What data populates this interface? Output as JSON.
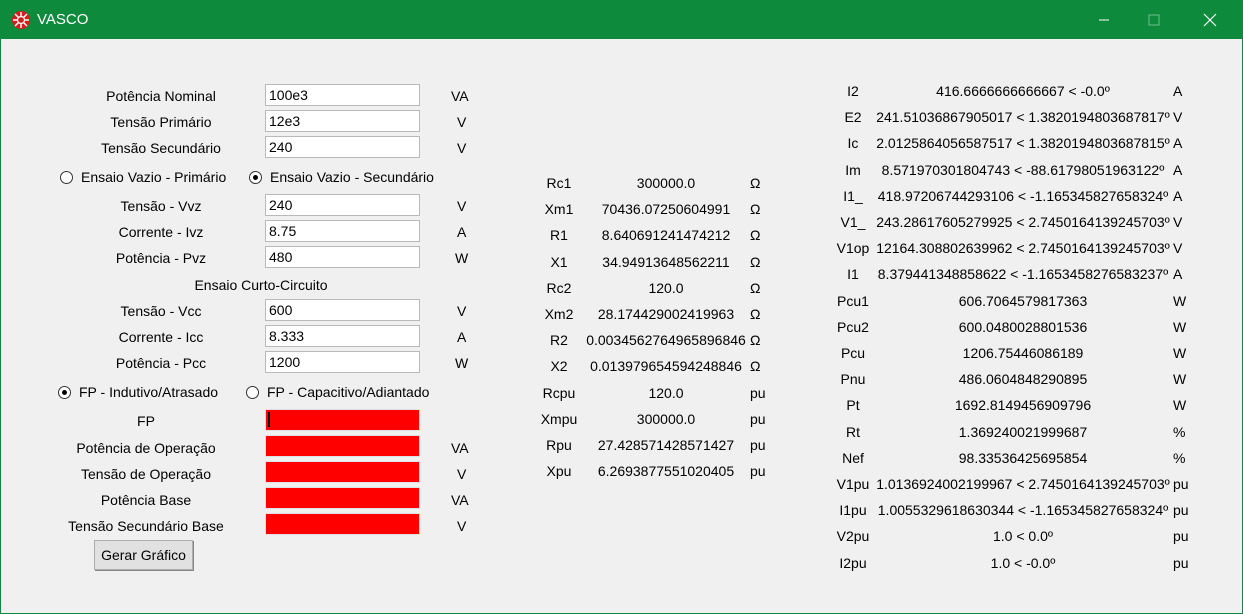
{
  "window": {
    "title": "VASCO",
    "icon": "vasco-app-icon",
    "accent": "#0e8a3c"
  },
  "inputs": {
    "potencia_nominal": {
      "label": "Potência Nominal",
      "value": "100e3",
      "unit": "VA"
    },
    "tensao_primario": {
      "label": "Tensão Primário",
      "value": "12e3",
      "unit": "V"
    },
    "tensao_secundario": {
      "label": "Tensão Secundário",
      "value": "240",
      "unit": "V"
    },
    "ensaio_vazio_radio": {
      "primario": {
        "label": "Ensaio Vazio - Primário",
        "checked": false
      },
      "secundario": {
        "label": "Ensaio Vazio - Secundário",
        "checked": true
      }
    },
    "vvz": {
      "label": "Tensão - Vvz",
      "value": "240",
      "unit": "V"
    },
    "ivz": {
      "label": "Corrente - Ivz",
      "value": "8.75",
      "unit": "A"
    },
    "pvz": {
      "label": "Potência - Pvz",
      "value": "480",
      "unit": "W"
    },
    "curto_circuito_heading": "Ensaio Curto-Circuito",
    "vcc": {
      "label": "Tensão - Vcc",
      "value": "600",
      "unit": "V"
    },
    "icc": {
      "label": "Corrente - Icc",
      "value": "8.333",
      "unit": "A"
    },
    "pcc": {
      "label": "Potência - Pcc",
      "value": "1200",
      "unit": "W"
    },
    "fp_radio": {
      "indutivo": {
        "label": "FP - Indutivo/Atrasado",
        "checked": true
      },
      "capacitivo": {
        "label": "FP - Capacitivo/Adiantado",
        "checked": false
      }
    },
    "fp": {
      "label": "FP",
      "value": "",
      "unit": ""
    },
    "potencia_operacao": {
      "label": "Potência de Operação",
      "value": "",
      "unit": "VA"
    },
    "tensao_operacao": {
      "label": "Tensão de Operação",
      "value": "",
      "unit": "V"
    },
    "potencia_base": {
      "label": "Potência Base",
      "value": "",
      "unit": "VA"
    },
    "tensao_secundario_base": {
      "label": "Tensão Secundário Base",
      "value": "",
      "unit": "V"
    },
    "error_field_color": "#ff0000",
    "gerar_grafico_label": "Gerar Gráfico"
  },
  "parameters": [
    {
      "name": "Rc1",
      "value": "300000.0",
      "unit": "Ω"
    },
    {
      "name": "Xm1",
      "value": "70436.07250604991",
      "unit": "Ω"
    },
    {
      "name": "R1",
      "value": "8.640691241474212",
      "unit": "Ω"
    },
    {
      "name": "X1",
      "value": "34.94913648562211",
      "unit": "Ω"
    },
    {
      "name": "Rc2",
      "value": "120.0",
      "unit": "Ω"
    },
    {
      "name": "Xm2",
      "value": "28.174429002419963",
      "unit": "Ω"
    },
    {
      "name": "R2",
      "value": "0.0034562764965896846",
      "unit": "Ω"
    },
    {
      "name": "X2",
      "value": "0.013979654594248846",
      "unit": "Ω"
    },
    {
      "name": "Rcpu",
      "value": "120.0",
      "unit": "pu"
    },
    {
      "name": "Xmpu",
      "value": "300000.0",
      "unit": "pu"
    },
    {
      "name": "Rpu",
      "value": "27.428571428571427",
      "unit": "pu"
    },
    {
      "name": "Xpu",
      "value": "6.2693877551020405",
      "unit": "pu"
    }
  ],
  "results": [
    {
      "name": "I2",
      "value": "416.6666666666667 < -0.0º",
      "unit": "A"
    },
    {
      "name": "E2",
      "value": "241.51036867905017 < 1.3820194803687817º",
      "unit": "V"
    },
    {
      "name": "Ic",
      "value": "2.0125864056587517 < 1.3820194803687815º",
      "unit": "A"
    },
    {
      "name": "Im",
      "value": "8.571970301804743 < -88.61798051963122º",
      "unit": "A"
    },
    {
      "name": "I1_",
      "value": "418.97206744293106 < -1.165345827658324º",
      "unit": "A"
    },
    {
      "name": "V1_",
      "value": "243.28617605279925 < 2.7450164139245703º",
      "unit": "V"
    },
    {
      "name": "V1op",
      "value": "12164.308802639962 < 2.7450164139245703º",
      "unit": "V"
    },
    {
      "name": "I1",
      "value": "8.379441348858622 < -1.1653458276583237º",
      "unit": "A"
    },
    {
      "name": "Pcu1",
      "value": "606.7064579817363",
      "unit": "W"
    },
    {
      "name": "Pcu2",
      "value": "600.0480028801536",
      "unit": "W"
    },
    {
      "name": "Pcu",
      "value": "1206.75446086189",
      "unit": "W"
    },
    {
      "name": "Pnu",
      "value": "486.0604848290895",
      "unit": "W"
    },
    {
      "name": "Pt",
      "value": "1692.8149456909796",
      "unit": "W"
    },
    {
      "name": "Rt",
      "value": "1.369240021999687",
      "unit": "%"
    },
    {
      "name": "Nef",
      "value": "98.33536425695854",
      "unit": "%"
    },
    {
      "name": "V1pu",
      "value": "1.0136924002199967 < 2.7450164139245703º",
      "unit": "pu"
    },
    {
      "name": "I1pu",
      "value": "1.0055329618630344 < -1.165345827658324º",
      "unit": "pu"
    },
    {
      "name": "V2pu",
      "value": "1.0 < 0.0º",
      "unit": "pu"
    },
    {
      "name": "I2pu",
      "value": "1.0 < -0.0º",
      "unit": "pu"
    }
  ]
}
